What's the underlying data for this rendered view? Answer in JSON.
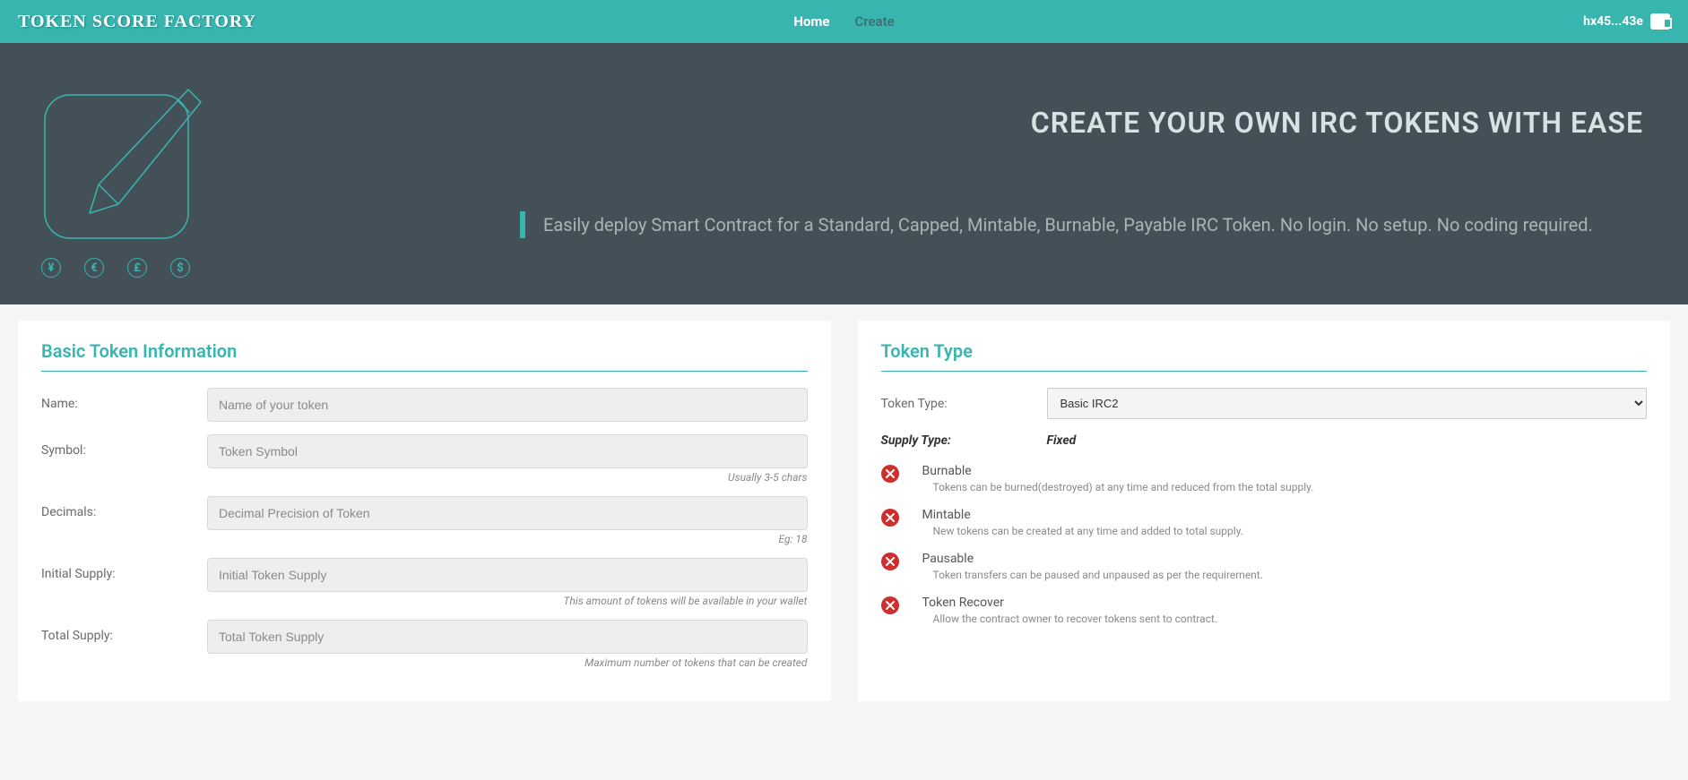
{
  "header": {
    "logo": "TOKEN SCORE FACTORY",
    "nav": {
      "home": "Home",
      "create": "Create"
    },
    "wallet": "hx45...43e"
  },
  "hero": {
    "title": "CREATE YOUR OWN IRC TOKENS WITH EASE",
    "quote": "Easily deploy Smart Contract for a Standard, Capped, Mintable, Burnable, Payable IRC Token. No login. No setup. No coding required.",
    "currencies": {
      "yen": "¥",
      "euro": "€",
      "pound": "£",
      "dollar": "$"
    }
  },
  "basic": {
    "title": "Basic Token Information",
    "name": {
      "label": "Name:",
      "placeholder": "Name of your token"
    },
    "symbol": {
      "label": "Symbol:",
      "placeholder": "Token Symbol",
      "hint": "Usually 3-5 chars"
    },
    "decimals": {
      "label": "Decimals:",
      "placeholder": "Decimal Precision of Token",
      "hint": "Eg: 18"
    },
    "initial": {
      "label": "Initial Supply:",
      "placeholder": "Initial Token Supply",
      "hint": "This amount of tokens will be available in your wallet"
    },
    "total": {
      "label": "Total Supply:",
      "placeholder": "Total Token Supply",
      "hint": "Maximum number ot tokens that can be created"
    }
  },
  "type": {
    "title": "Token Type",
    "label": "Token Type:",
    "selected": "Basic IRC2",
    "supply_label": "Supply Type:",
    "supply_value": "Fixed",
    "features": [
      {
        "name": "Burnable",
        "desc": "Tokens can be burned(destroyed) at any time and reduced from the total supply."
      },
      {
        "name": "Mintable",
        "desc": "New tokens can be created at any time and added to total supply."
      },
      {
        "name": "Pausable",
        "desc": "Token transfers can be paused and unpaused as per the requirement."
      },
      {
        "name": "Token Recover",
        "desc": "Allow the contract owner to recover tokens sent to contract."
      }
    ]
  }
}
